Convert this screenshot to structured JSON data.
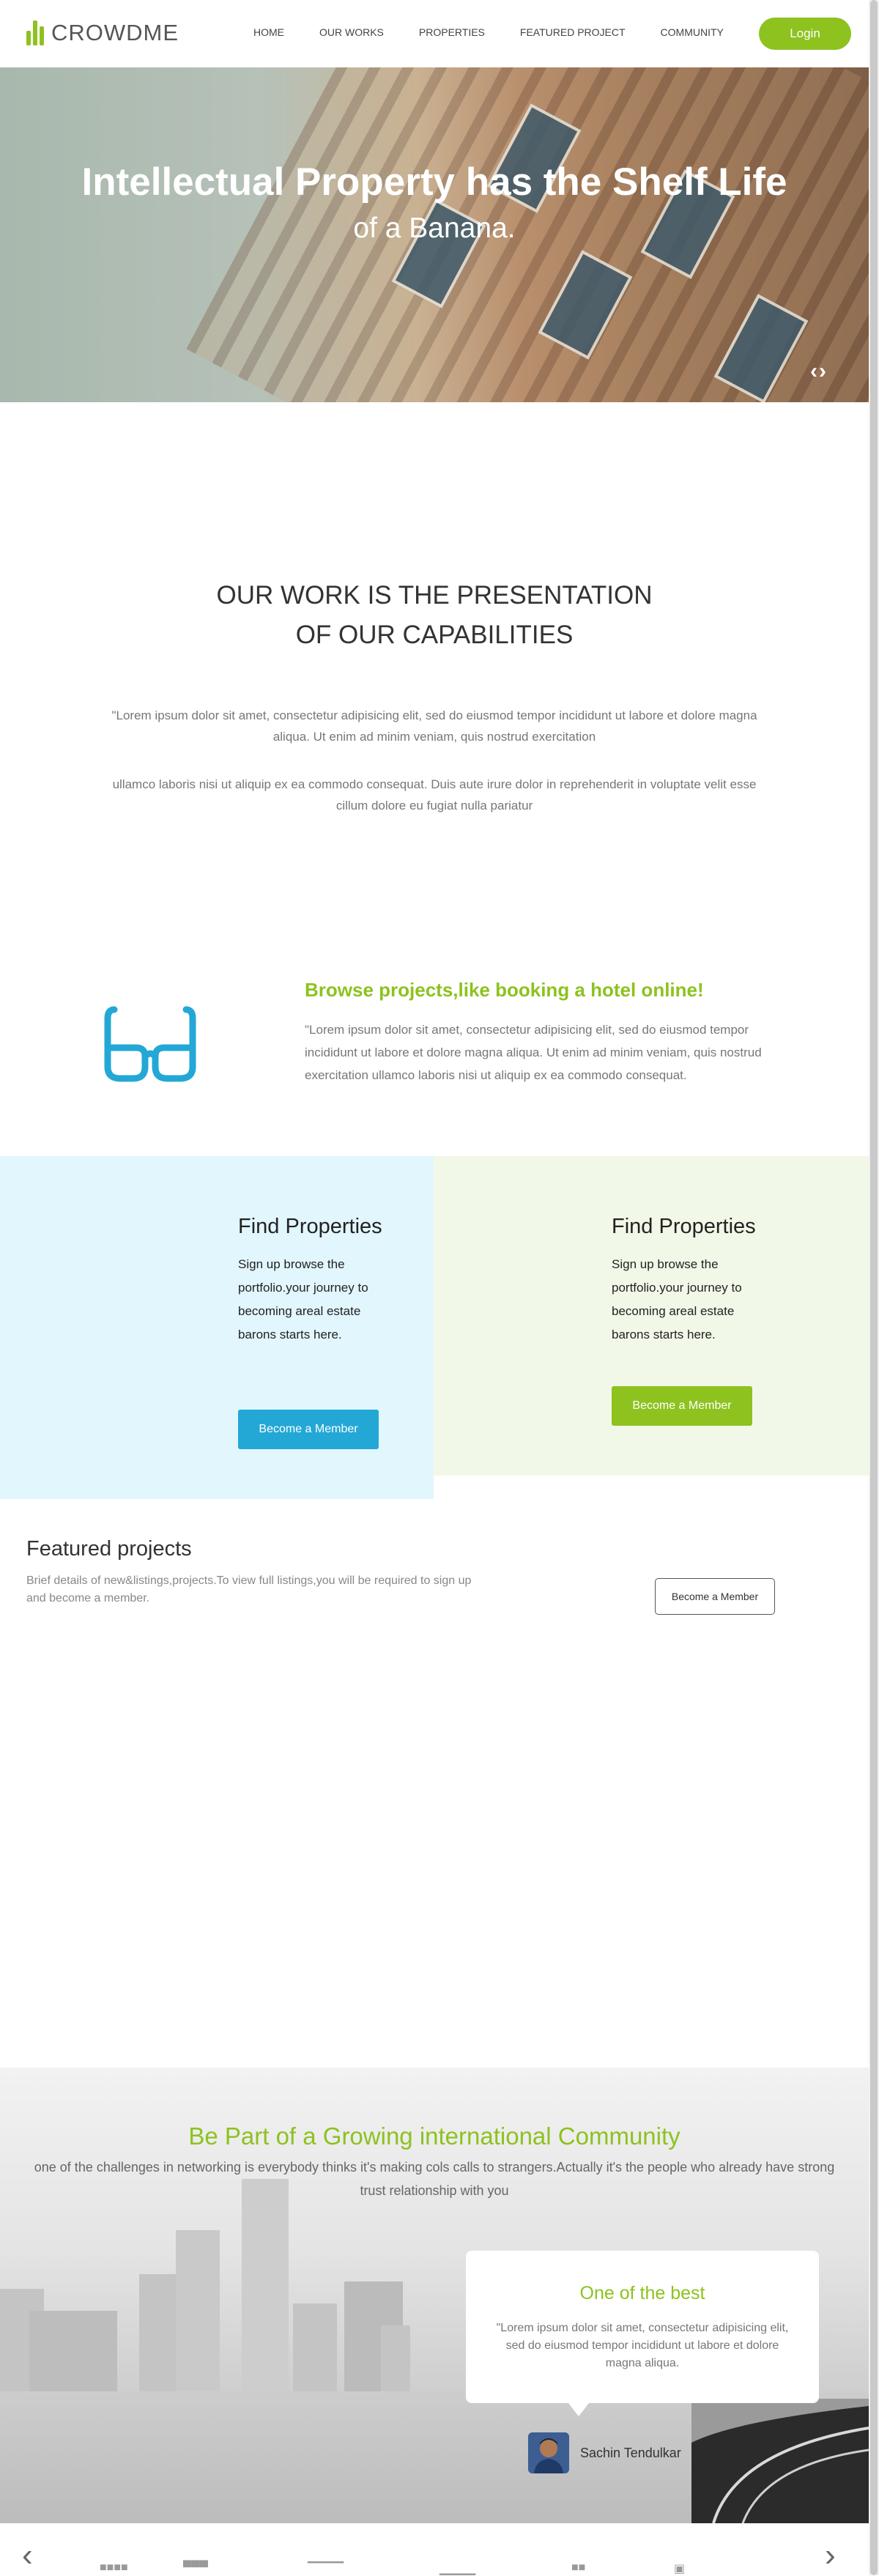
{
  "header": {
    "logo_text": "CROWDME",
    "nav": [
      "HOME",
      "OUR WORKS",
      "PROPERTIES",
      "FEATURED PROJECT",
      "COMMUNITY"
    ],
    "login_label": "Login",
    "accent": "#8dc21f"
  },
  "hero": {
    "headline": "Intellectual Property has the Shelf Life",
    "subheadline": "of a Banana.",
    "arrows": "‹›"
  },
  "capabilities": {
    "title_line1": "OUR WORK IS THE PRESENTATION",
    "title_line2": "OF OUR CAPABILITIES",
    "para1": "\"Lorem ipsum dolor sit amet, consectetur adipisicing elit, sed do eiusmod tempor incididunt ut labore et dolore magna aliqua. Ut enim ad minim veniam, quis nostrud exercitation",
    "para2": "ullamco laboris nisi ut aliquip ex ea commodo consequat. Duis aute irure dolor in reprehenderit in voluptate velit esse cillum dolore eu fugiat nulla pariatur"
  },
  "browse": {
    "icon": "glasses-icon",
    "title": "Browse projects,like booking a hotel online!",
    "text": "\"Lorem ipsum dolor sit amet, consectetur adipisicing elit, sed do eiusmod tempor incididunt ut labore et dolore magna aliqua. Ut enim ad minim veniam, quis nostrud exercitation ullamco laboris nisi ut aliquip ex ea commodo consequat."
  },
  "find": {
    "left": {
      "title": "Find Properties",
      "text": "Sign up browse the portfolio.your journey to becoming areal estate barons starts here.",
      "button": "Become a Member",
      "bg": "#e2f6fd",
      "button_color": "#23a8d6"
    },
    "right": {
      "title": "Find Properties",
      "text": "Sign up browse the portfolio.your journey to becoming areal estate barons starts here.",
      "button": "Become a Member",
      "bg": "#f2f8e8",
      "button_color": "#8dc21f"
    }
  },
  "featured": {
    "title": "Featured projects",
    "text": "Brief details of new&listings,projects.To view full listings,you will be required to sign up and become a member.",
    "button": "Become a Member"
  },
  "community": {
    "title": "Be Part of a Growing international Community",
    "text": "one of the challenges in networking is everybody thinks it's making cols calls to strangers.Actually it's the people who already have strong trust relationship with you",
    "testimonial": {
      "title": "One of the best",
      "text": "\"Lorem ipsum dolor sit amet, consectetur adipisicing elit, sed do eiusmod tempor incididunt ut labore et dolore magna aliqua.",
      "name": "Sachin Tendulkar"
    }
  },
  "logos": {
    "prev": "‹",
    "next": "›"
  }
}
